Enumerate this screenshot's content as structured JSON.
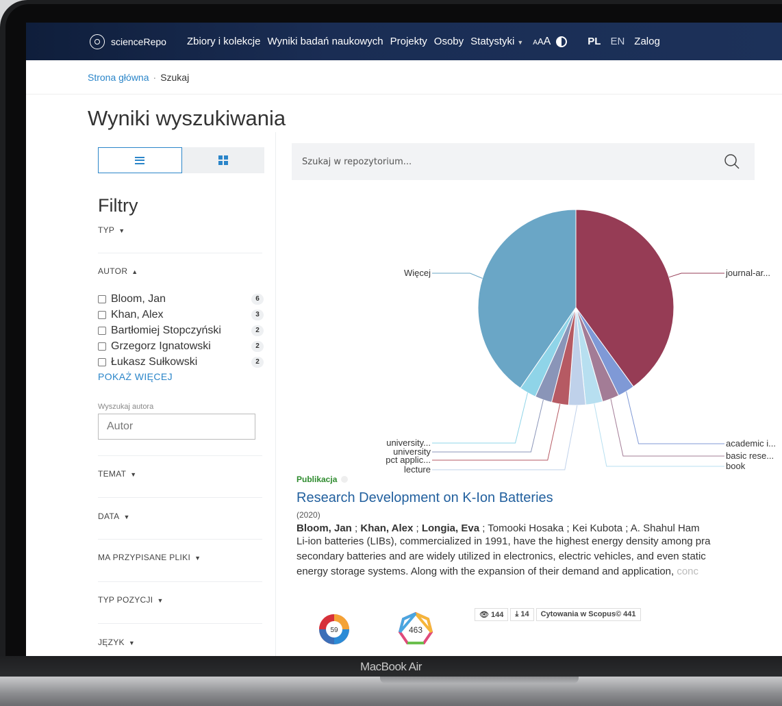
{
  "device": {
    "label": "MacBook Air"
  },
  "navbar": {
    "logo_text": "scienceRepo",
    "items": [
      "Zbiory i kolekcje",
      "Wyniki badań naukowych",
      "Projekty",
      "Osoby",
      "Statystyki"
    ],
    "font_size_small": "A",
    "font_size_mid": "A",
    "font_size_large": "A",
    "lang_pl": "PL",
    "lang_en": "EN",
    "login": "Zalog"
  },
  "breadcrumb": {
    "home": "Strona główna",
    "separator": "·",
    "current": "Szukaj"
  },
  "page_title": "Wyniki wyszukiwania",
  "sidebar": {
    "filters_title": "Filtry",
    "sections": {
      "type": "TYP",
      "author": "AUTOR",
      "topic": "TEMAT",
      "date": "DATA",
      "has_files": "MA PRZYPISANE PLIKI",
      "item_type": "TYP POZYCJI",
      "language": "JĘZYK"
    },
    "authors": [
      {
        "name": "Bloom, Jan",
        "count": "6"
      },
      {
        "name": "Khan, Alex",
        "count": "3"
      },
      {
        "name": "Bartłomiej Stopczyński",
        "count": "2"
      },
      {
        "name": "Grzegorz Ignatowski",
        "count": "2"
      },
      {
        "name": "Łukasz Sułkowski",
        "count": "2"
      }
    ],
    "show_more": "POKAŻ WIĘCEJ",
    "author_search_label": "Wyszukaj autora",
    "author_search_placeholder": "Autor"
  },
  "search": {
    "placeholder": "Szukaj w repozytorium..."
  },
  "chart_data": {
    "type": "pie",
    "categories": [
      "journal-ar...",
      "academic i...",
      "basic rese...",
      "book",
      "lecture",
      "pct applic...",
      "university",
      "university...",
      "Więcej"
    ],
    "values": [
      40,
      2.8,
      2.8,
      2.8,
      2.8,
      2.8,
      2.8,
      2.8,
      40.4
    ],
    "colors": [
      "#963c55",
      "#7f99d6",
      "#a37c96",
      "#b7dff0",
      "#bfd1ea",
      "#b65a63",
      "#8a95b8",
      "#8fd4e8",
      "#6aa6c6"
    ]
  },
  "result": {
    "type_label": "Publikacja",
    "title": "Research Development on K-Ion Batteries",
    "year": "(2020)",
    "authors_bold": [
      "Bloom, Jan",
      "Khan, Alex",
      "Longia, Eva"
    ],
    "authors_plain": [
      "Tomooki Hosaka",
      "Kei Kubota",
      "A. Shahul Ham"
    ],
    "abstract_lines": [
      "Li-ion batteries (LIBs), commercialized in 1991, have the highest energy density among pra",
      "secondary batteries and are widely utilized in electronics, electric vehicles, and even static",
      "energy storage systems. Along with the expansion of their demand and application, "
    ],
    "abstract_fade": "conc",
    "altmetric_score": "59",
    "dimensions_score": "463",
    "views": "144",
    "downloads": "14",
    "scopus_citations": "Cytowania w Scopus© 441"
  }
}
